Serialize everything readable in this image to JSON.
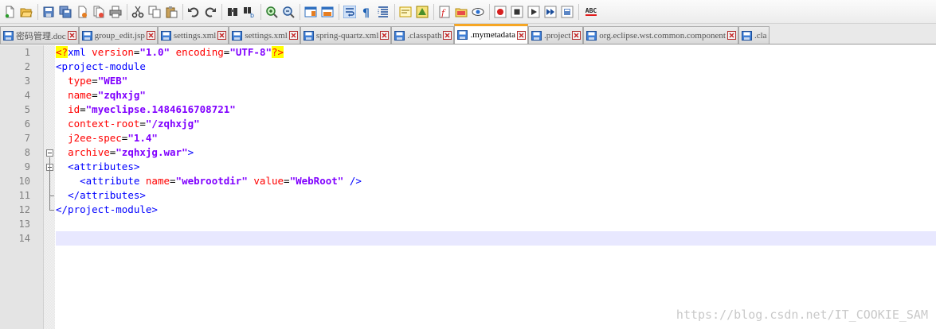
{
  "toolbar": {
    "icons": [
      "new-file-icon",
      "open-file-icon",
      "save-icon",
      "save-all-icon",
      "close-icon",
      "close-all-icon",
      "print-icon",
      "cut-icon",
      "copy-icon",
      "paste-icon",
      "undo-icon",
      "redo-icon",
      "find-icon",
      "replace-icon",
      "zoom-in-icon",
      "zoom-out-icon",
      "sync-vertical-icon",
      "sync-horizontal-icon",
      "word-wrap-icon",
      "show-all-chars-icon",
      "indent-guide-icon",
      "user-language-icon",
      "document-map-icon",
      "function-list-icon",
      "folder-workspace-icon",
      "monitor-icon",
      "record-macro-icon",
      "stop-macro-icon",
      "play-macro-icon",
      "run-macro-multiple-icon",
      "save-macro-icon"
    ],
    "spellcheck_label": "ABC"
  },
  "tabs": [
    {
      "label": "密码管理.doc",
      "active": false
    },
    {
      "label": "group_edit.jsp",
      "active": false
    },
    {
      "label": "settings.xml",
      "active": false
    },
    {
      "label": "settings.xml",
      "active": false
    },
    {
      "label": "spring-quartz.xml",
      "active": false
    },
    {
      "label": ".classpath",
      "active": false
    },
    {
      "label": ".mymetadata",
      "active": true
    },
    {
      "label": ".project",
      "active": false
    },
    {
      "label": "org.eclipse.wst.common.component",
      "active": false
    },
    {
      "label": ".cla",
      "active": false
    }
  ],
  "editor": {
    "line_numbers": [
      "1",
      "2",
      "3",
      "4",
      "5",
      "6",
      "7",
      "8",
      "9",
      "10",
      "11",
      "12",
      "13",
      "14"
    ],
    "current_line": 14,
    "lines": [
      [
        {
          "t": "pi",
          "v": "<?"
        },
        {
          "t": "tag",
          "v": "xml "
        },
        {
          "t": "attr",
          "v": "version"
        },
        {
          "t": "eq",
          "v": "="
        },
        {
          "t": "val",
          "v": "\"1.0\""
        },
        {
          "t": "txt",
          "v": " "
        },
        {
          "t": "attr",
          "v": "encoding"
        },
        {
          "t": "eq",
          "v": "="
        },
        {
          "t": "val",
          "v": "\"UTF-8\""
        },
        {
          "t": "pi",
          "v": "?>"
        }
      ],
      [
        {
          "t": "tag",
          "v": "<project-module"
        }
      ],
      [
        {
          "t": "txt",
          "v": "  "
        },
        {
          "t": "attr",
          "v": "type"
        },
        {
          "t": "eq",
          "v": "="
        },
        {
          "t": "val",
          "v": "\"WEB\""
        }
      ],
      [
        {
          "t": "txt",
          "v": "  "
        },
        {
          "t": "attr",
          "v": "name"
        },
        {
          "t": "eq",
          "v": "="
        },
        {
          "t": "val",
          "v": "\"zqhxjg\""
        }
      ],
      [
        {
          "t": "txt",
          "v": "  "
        },
        {
          "t": "attr",
          "v": "id"
        },
        {
          "t": "eq",
          "v": "="
        },
        {
          "t": "val",
          "v": "\"myeclipse.1484616708721\""
        }
      ],
      [
        {
          "t": "txt",
          "v": "  "
        },
        {
          "t": "attr",
          "v": "context-root"
        },
        {
          "t": "eq",
          "v": "="
        },
        {
          "t": "val",
          "v": "\"/zqhxjg\""
        }
      ],
      [
        {
          "t": "txt",
          "v": "  "
        },
        {
          "t": "attr",
          "v": "j2ee-spec"
        },
        {
          "t": "eq",
          "v": "="
        },
        {
          "t": "val",
          "v": "\"1.4\""
        }
      ],
      [
        {
          "t": "txt",
          "v": "  "
        },
        {
          "t": "attr",
          "v": "archive"
        },
        {
          "t": "eq",
          "v": "="
        },
        {
          "t": "val",
          "v": "\"zqhxjg.war\""
        },
        {
          "t": "tag",
          "v": ">"
        }
      ],
      [
        {
          "t": "txt",
          "v": "  "
        },
        {
          "t": "tag",
          "v": "<attributes>"
        }
      ],
      [
        {
          "t": "txt",
          "v": "    "
        },
        {
          "t": "tag",
          "v": "<attribute "
        },
        {
          "t": "attr",
          "v": "name"
        },
        {
          "t": "eq",
          "v": "="
        },
        {
          "t": "val",
          "v": "\"webrootdir\""
        },
        {
          "t": "txt",
          "v": " "
        },
        {
          "t": "attr",
          "v": "value"
        },
        {
          "t": "eq",
          "v": "="
        },
        {
          "t": "val",
          "v": "\"WebRoot\""
        },
        {
          "t": "tag",
          "v": " />"
        }
      ],
      [
        {
          "t": "txt",
          "v": "  "
        },
        {
          "t": "tag",
          "v": "</attributes>"
        }
      ],
      [
        {
          "t": "tag",
          "v": "</project-module>"
        }
      ],
      [],
      []
    ]
  },
  "watermark": "https://blog.csdn.net/IT_COOKIE_SAM"
}
